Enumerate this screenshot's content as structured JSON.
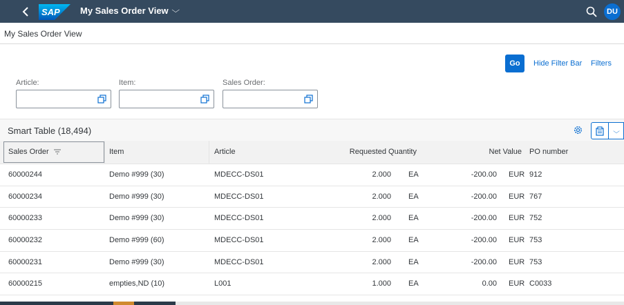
{
  "shell": {
    "app_title": "My Sales Order View",
    "avatar_initials": "DU",
    "brand_color": "#354a5f",
    "accent_color": "#0a6ed1"
  },
  "page": {
    "title": "My Sales Order View"
  },
  "filterbar": {
    "go_label": "Go",
    "hide_filter_label": "Hide Filter Bar",
    "filters_label": "Filters",
    "fields": [
      {
        "label": "Article:",
        "value": ""
      },
      {
        "label": "Item:",
        "value": ""
      },
      {
        "label": "Sales Order:",
        "value": ""
      }
    ]
  },
  "table": {
    "title": "Smart Table (18,494)",
    "columns": [
      "Sales Order",
      "Item",
      "Article",
      "Requested Quantity",
      "Net Value",
      "PO number"
    ],
    "rows": [
      {
        "sales_order": "60000244",
        "item": "Demo #999 (30)",
        "article": "MDECC-DS01",
        "qty": "2.000",
        "uom": "EA",
        "net_value": "-200.00",
        "currency": "EUR",
        "po": "912"
      },
      {
        "sales_order": "60000234",
        "item": "Demo #999 (30)",
        "article": "MDECC-DS01",
        "qty": "2.000",
        "uom": "EA",
        "net_value": "-200.00",
        "currency": "EUR",
        "po": "767"
      },
      {
        "sales_order": "60000233",
        "item": "Demo #999 (30)",
        "article": "MDECC-DS01",
        "qty": "2.000",
        "uom": "EA",
        "net_value": "-200.00",
        "currency": "EUR",
        "po": "752"
      },
      {
        "sales_order": "60000232",
        "item": "Demo #999 (60)",
        "article": "MDECC-DS01",
        "qty": "2.000",
        "uom": "EA",
        "net_value": "-200.00",
        "currency": "EUR",
        "po": "753"
      },
      {
        "sales_order": "60000231",
        "item": "Demo #999 (30)",
        "article": "MDECC-DS01",
        "qty": "2.000",
        "uom": "EA",
        "net_value": "-200.00",
        "currency": "EUR",
        "po": "753"
      },
      {
        "sales_order": "60000215",
        "item": "empties,ND (10)",
        "article": "L001",
        "qty": "1.000",
        "uom": "EA",
        "net_value": "0.00",
        "currency": "EUR",
        "po": "C0033"
      }
    ]
  },
  "icons": {
    "back": "back-arrow-icon",
    "title_menu": "chevron-down-icon",
    "search": "search-icon",
    "value_help": "value-help-icon",
    "sort": "sort-icon",
    "settings": "gear-icon",
    "export": "export-icon",
    "export_menu": "chevron-down-icon"
  }
}
